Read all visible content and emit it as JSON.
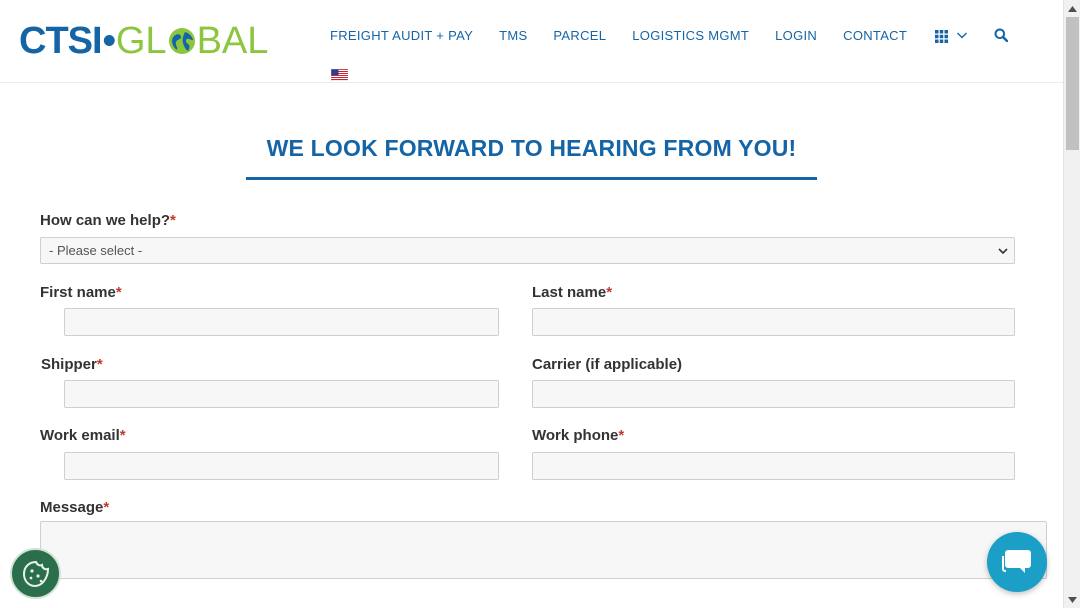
{
  "header": {
    "logo": {
      "part1": "CTSI",
      "sep": "•",
      "part2a": "GL",
      "part2b": "BAL"
    },
    "nav": [
      {
        "label": "FREIGHT AUDIT + PAY"
      },
      {
        "label": "TMS"
      },
      {
        "label": "PARCEL"
      },
      {
        "label": "LOGISTICS MGMT"
      },
      {
        "label": "LOGIN"
      },
      {
        "label": "CONTACT"
      }
    ],
    "icons": {
      "apps": "grid-icon",
      "dropdown": "chevron-down-icon",
      "search": "search-icon",
      "language": "us-flag-icon"
    }
  },
  "hero": {
    "title": "WE LOOK FORWARD TO HEARING FROM YOU!"
  },
  "form": {
    "help": {
      "label": "How can we help?",
      "required": "*",
      "selected": "- Please select -"
    },
    "first_name": {
      "label": "First name",
      "required": "*",
      "value": ""
    },
    "last_name": {
      "label": "Last name",
      "required": "*",
      "value": ""
    },
    "shipper": {
      "label": "Shipper",
      "required": "*",
      "value": ""
    },
    "carrier": {
      "label": "Carrier (if applicable)",
      "value": ""
    },
    "work_email": {
      "label": "Work email",
      "required": "*",
      "value": ""
    },
    "work_phone": {
      "label": "Work phone",
      "required": "*",
      "value": ""
    },
    "message": {
      "label": "Message",
      "required": "*",
      "value": ""
    }
  },
  "widgets": {
    "cookie": "cookie-icon",
    "chat": "chat-icon"
  },
  "colors": {
    "brand_blue": "#1565a6",
    "brand_green": "#8cc63f",
    "required_red": "#c0392b",
    "chat_teal": "#1b9fc7",
    "cookie_green": "#2b6e4c"
  }
}
